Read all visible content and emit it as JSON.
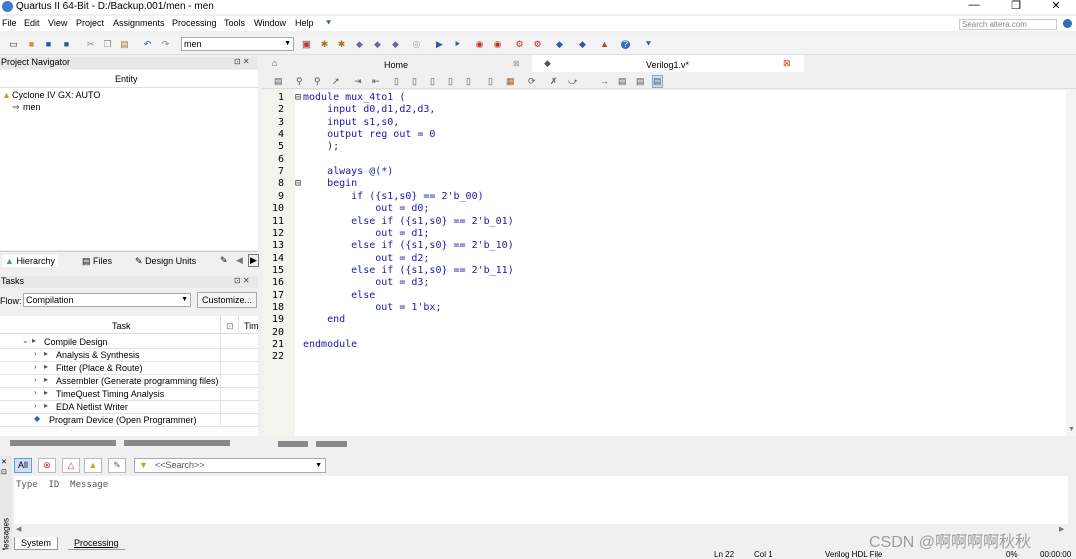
{
  "window": {
    "title": "Quartus II 64-Bit - D:/Backup.001/men - men",
    "minimize": "—",
    "maximize": "❐",
    "close": "✕"
  },
  "menu": [
    "File",
    "Edit",
    "View",
    "Project",
    "Assignments",
    "Processing",
    "Tools",
    "Window",
    "Help"
  ],
  "search": {
    "placeholder": "Search altera.com"
  },
  "toolbar": {
    "revision": "men"
  },
  "project_navigator": {
    "title": "Project Navigator",
    "column": "Entity",
    "device": "Cyclone IV GX: AUTO",
    "entity": "men",
    "tabs": [
      "Hierarchy",
      "Files",
      "Design Units"
    ]
  },
  "tasks": {
    "title": "Tasks",
    "flow_label": "Flow:",
    "flow_value": "Compilation",
    "customize": "Customize...",
    "col_task": "Task",
    "col_time": "Tim",
    "items": [
      {
        "label": "Compile Design",
        "level": 0
      },
      {
        "label": "Analysis & Synthesis",
        "level": 1
      },
      {
        "label": "Fitter (Place & Route)",
        "level": 1
      },
      {
        "label": "Assembler (Generate programming files)",
        "level": 1
      },
      {
        "label": "TimeQuest Timing Analysis",
        "level": 1
      },
      {
        "label": "EDA Netlist Writer",
        "level": 1
      },
      {
        "label": "Program Device (Open Programmer)",
        "level": 0
      }
    ]
  },
  "editor": {
    "tabs": [
      {
        "label": "Home"
      },
      {
        "label": "Verilog1.v*"
      }
    ],
    "lines": [
      "module mux_4to1 (",
      "    input d0,d1,d2,d3,",
      "    input s1,s0,",
      "    output reg out = 0",
      "    );",
      "",
      "    always @(*)",
      "    begin",
      "        if ({s1,s0} == 2'b_00)",
      "            out = d0;",
      "        else if ({s1,s0} == 2'b_01)",
      "            out = d1;",
      "        else if ({s1,s0} == 2'b_10)",
      "            out = d2;",
      "        else if ({s1,s0} == 2'b_11)",
      "            out = d3;",
      "        else",
      "            out = 1'bx;",
      "    end",
      "",
      "endmodule",
      ""
    ]
  },
  "messages": {
    "side_label": "Messages",
    "all_button": "All",
    "search_placeholder": "<<Search>>",
    "columns": "Type  ID  Message",
    "tabs": [
      "System",
      "Processing"
    ]
  },
  "status": {
    "position": "Ln 22",
    "column": "Col 1",
    "file_type": "Verilog HDL File",
    "progress": "0%",
    "time": "00:00:00"
  },
  "watermark": "CSDN @啊啊啊啊秋秋"
}
